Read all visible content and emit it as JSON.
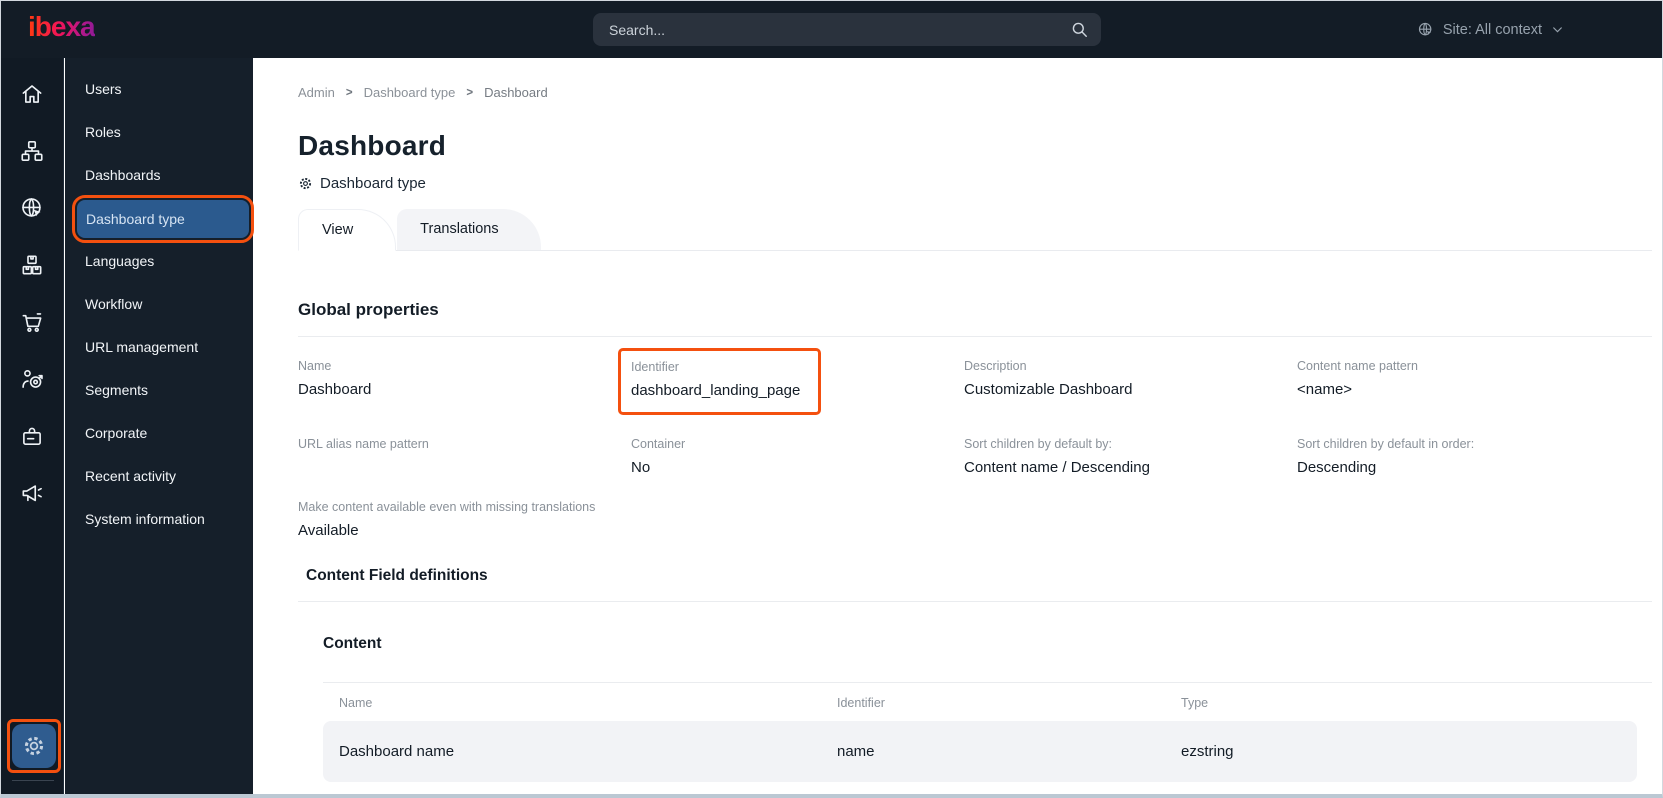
{
  "topbar": {
    "logo": "ibexa",
    "search": {
      "placeholder": "Search..."
    },
    "site_selector": {
      "label": "Site: All context"
    }
  },
  "rail": {
    "items": [
      {
        "icon": "home-icon"
      },
      {
        "icon": "content-tree-icon"
      },
      {
        "icon": "site-globe-icon"
      },
      {
        "icon": "product-catalog-icon"
      },
      {
        "icon": "commerce-cart-icon"
      },
      {
        "icon": "personalization-target-icon"
      },
      {
        "icon": "corporate-badge-icon"
      },
      {
        "icon": "marketing-megaphone-icon"
      }
    ],
    "settings_icon": "gear-icon"
  },
  "sidebar": {
    "items": [
      "Users",
      "Roles",
      "Dashboards",
      "Dashboard type",
      "Languages",
      "Workflow",
      "URL management",
      "Segments",
      "Corporate",
      "Recent activity",
      "System information"
    ],
    "selected": "Dashboard type"
  },
  "breadcrumb": {
    "items": [
      "Admin",
      "Dashboard type",
      "Dashboard"
    ],
    "separator": ">"
  },
  "page": {
    "title": "Dashboard",
    "type_label": "Dashboard type"
  },
  "tabs": {
    "view": "View",
    "translations": "Translations",
    "active": "View"
  },
  "global_properties": {
    "heading": "Global properties",
    "fields": [
      {
        "label": "Name",
        "value": "Dashboard"
      },
      {
        "label": "Identifier",
        "value": "dashboard_landing_page",
        "highlighted": true
      },
      {
        "label": "Description",
        "value": "Customizable Dashboard"
      },
      {
        "label": "Content name pattern",
        "value": "<name>"
      },
      {
        "label": "URL alias name pattern",
        "value": ""
      },
      {
        "label": "Container",
        "value": "No"
      },
      {
        "label": "Sort children by default by:",
        "value": "Content name / Descending"
      },
      {
        "label": "Sort children by default in order:",
        "value": "Descending"
      },
      {
        "label": "Make content available even with missing translations",
        "value": "Available"
      }
    ]
  },
  "field_definitions": {
    "heading": "Content Field definitions",
    "group_heading": "Content",
    "table": {
      "headers": [
        "Name",
        "Identifier",
        "Type"
      ],
      "rows": [
        [
          "Dashboard name",
          "name",
          "ezstring"
        ]
      ]
    }
  },
  "colors": {
    "accent_orange": "#f4500f",
    "selected_blue": "#2b5a8e",
    "dark_bg": "#131c26",
    "row_bg": "#f2f3f6"
  }
}
